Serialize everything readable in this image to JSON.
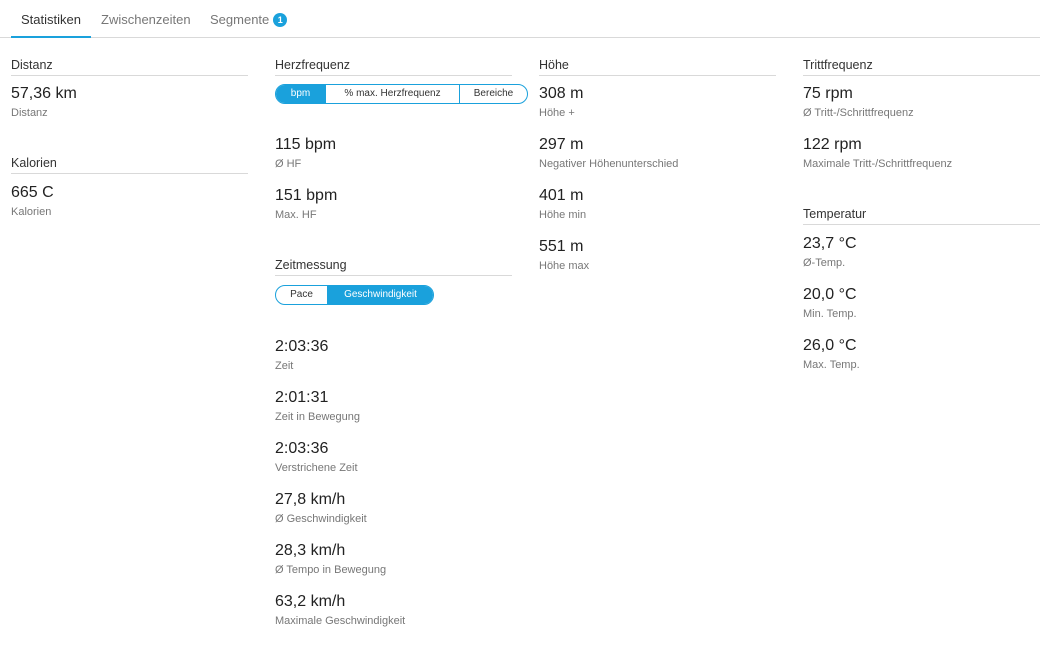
{
  "tabs": [
    {
      "label": "Statistiken"
    },
    {
      "label": "Zwischenzeiten"
    },
    {
      "label": "Segmente",
      "badge": "1"
    }
  ],
  "colors": {
    "accent": "#1aa1dc"
  },
  "distanz": {
    "title": "Distanz",
    "stats": [
      {
        "value": "57,36 km",
        "label": "Distanz"
      }
    ]
  },
  "kalorien": {
    "title": "Kalorien",
    "stats": [
      {
        "value": "665 C",
        "label": "Kalorien"
      }
    ]
  },
  "herzfrequenz": {
    "title": "Herzfrequenz",
    "toggle": {
      "options": [
        "bpm",
        "% max. Herzfrequenz",
        "Bereiche"
      ],
      "selected": "bpm"
    },
    "stats": [
      {
        "value": "115 bpm",
        "label": "Ø HF"
      },
      {
        "value": "151 bpm",
        "label": "Max. HF"
      }
    ]
  },
  "zeitmessung": {
    "title": "Zeitmessung",
    "toggle": {
      "options": [
        "Pace",
        "Geschwindigkeit"
      ],
      "selected": "Geschwindigkeit"
    },
    "stats": [
      {
        "value": "2:03:36",
        "label": "Zeit"
      },
      {
        "value": "2:01:31",
        "label": "Zeit in Bewegung"
      },
      {
        "value": "2:03:36",
        "label": "Verstrichene Zeit"
      },
      {
        "value": "27,8 km/h",
        "label": "Ø Geschwindigkeit"
      },
      {
        "value": "28,3 km/h",
        "label": "Ø Tempo in Bewegung"
      },
      {
        "value": "63,2 km/h",
        "label": "Maximale Geschwindigkeit"
      }
    ]
  },
  "hoehe": {
    "title": "Höhe",
    "stats": [
      {
        "value": "308 m",
        "label": "Höhe +"
      },
      {
        "value": "297 m",
        "label": "Negativer Höhenunterschied"
      },
      {
        "value": "401 m",
        "label": "Höhe min"
      },
      {
        "value": "551 m",
        "label": "Höhe max"
      }
    ]
  },
  "trittfrequenz": {
    "title": "Trittfrequenz",
    "stats": [
      {
        "value": "75 rpm",
        "label": "Ø Tritt-/Schrittfrequenz"
      },
      {
        "value": "122 rpm",
        "label": "Maximale Tritt-/Schrittfrequenz"
      }
    ]
  },
  "temperatur": {
    "title": "Temperatur",
    "stats": [
      {
        "value": "23,7 °C",
        "label": "Ø-Temp."
      },
      {
        "value": "20,0 °C",
        "label": "Min. Temp."
      },
      {
        "value": "26,0 °C",
        "label": "Max. Temp."
      }
    ]
  }
}
